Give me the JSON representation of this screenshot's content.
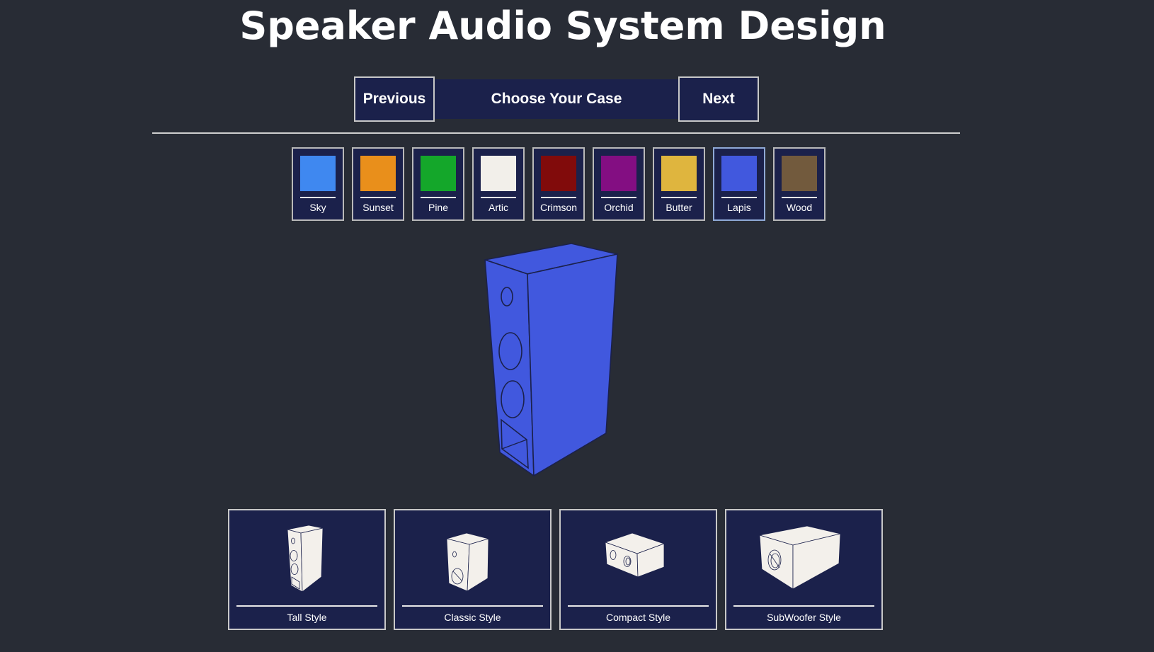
{
  "header": {
    "title": "Speaker Audio System Design"
  },
  "nav": {
    "previous_label": "Previous",
    "step_label": "Choose Your Case",
    "next_label": "Next"
  },
  "colors": {
    "selected": "Lapis",
    "swatches": [
      {
        "name": "Sky",
        "hex": "#3f88f0"
      },
      {
        "name": "Sunset",
        "hex": "#e98f1b"
      },
      {
        "name": "Pine",
        "hex": "#14a72a"
      },
      {
        "name": "Artic",
        "hex": "#f2efea"
      },
      {
        "name": "Crimson",
        "hex": "#810b0b"
      },
      {
        "name": "Orchid",
        "hex": "#830e82"
      },
      {
        "name": "Butter",
        "hex": "#dfb53e"
      },
      {
        "name": "Lapis",
        "hex": "#4158de"
      },
      {
        "name": "Wood",
        "hex": "#725a3d"
      }
    ]
  },
  "preview": {
    "case_color": "#4158de",
    "outline_color": "#1b214b"
  },
  "styles": {
    "items": [
      {
        "label": "Tall Style"
      },
      {
        "label": "Classic Style"
      },
      {
        "label": "Compact Style"
      },
      {
        "label": "SubWoofer Style"
      }
    ]
  }
}
